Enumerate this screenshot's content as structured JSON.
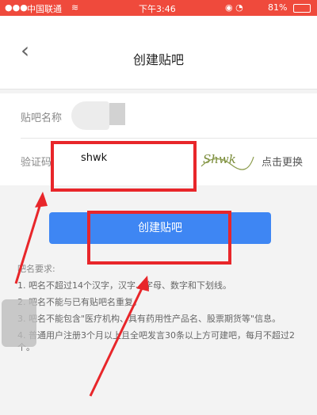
{
  "status": {
    "carrier": "中国联通",
    "wifi_icon": "wifi-icon",
    "time": "下午3:46",
    "battery": "81%"
  },
  "header": {
    "back_icon": "chevron-left-icon",
    "title": "创建贴吧"
  },
  "form": {
    "name_label": "贴吧名称",
    "code_label": "验证码",
    "code_value": "shwk",
    "captcha_text": "Shwk",
    "refresh_label": "点击更换"
  },
  "submit_label": "创建贴吧",
  "rules": {
    "title": "吧名要求:",
    "items": [
      "1. 吧名不超过14个汉字，汉字、字母、数字和下划线。",
      "2. 吧名不能与已有贴吧名重复。",
      "3. 吧名不能包含\"医疗机构、具有药用性产品名、股票期货等\"信息。",
      "4. 普通用户注册3个月以上且全吧发言30条以上方可建吧，每月不超过2个。"
    ]
  },
  "colors": {
    "status_bar": "#ef4a3c",
    "button": "#3e86f3",
    "annotation": "#e8262a"
  }
}
